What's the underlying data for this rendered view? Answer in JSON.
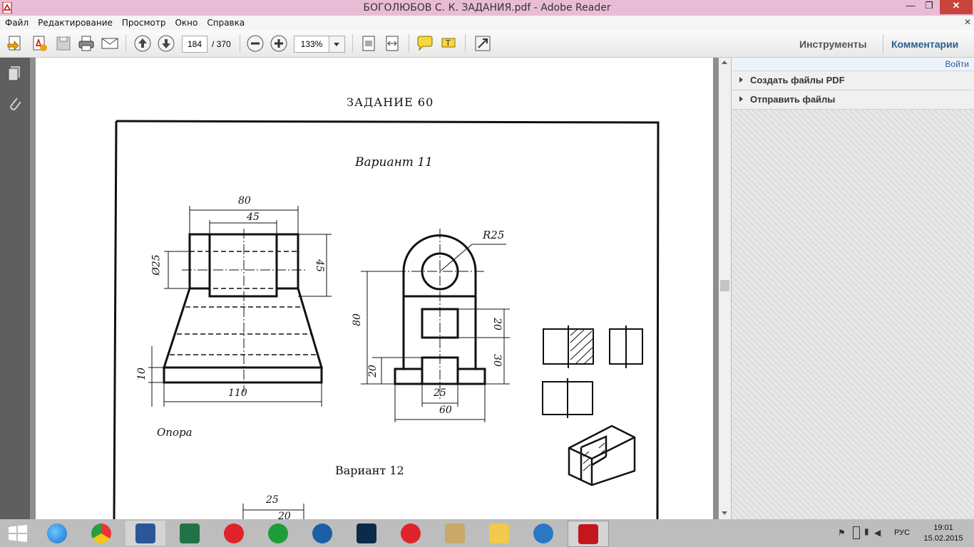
{
  "window": {
    "title": "БОГОЛЮБОВ С. К. ЗАДАНИЯ.pdf - Adobe Reader"
  },
  "menu": [
    "Файл",
    "Редактирование",
    "Просмотр",
    "Окно",
    "Справка"
  ],
  "toolbar": {
    "page_current": "184",
    "page_total": "/ 370",
    "zoom": "133%",
    "tools_label": "Инструменты",
    "comments_label": "Комментарии"
  },
  "panel": {
    "signin": "Войти",
    "items": [
      {
        "label": "Создать файлы PDF"
      },
      {
        "label": "Отправить файлы"
      }
    ]
  },
  "document": {
    "task_title": "ЗАДАНИЕ 60",
    "variant_11": "Вариант 11",
    "variant_12": "Вариант 12",
    "part_name": "Опора",
    "dims": {
      "d80_top": "80",
      "d45_top": "45",
      "d25_dia": "Ø25",
      "d45_side": "45",
      "d10": "10",
      "d110": "110",
      "r25": "R25",
      "d80_left": "80",
      "d20_right": "20",
      "d30_right": "30",
      "d20_left": "20",
      "d25_bottom": "25",
      "d60_bottom": "60",
      "d25_v12": "25",
      "d20_v12": "20"
    }
  },
  "taskbar": {
    "lang": "РУС",
    "time": "19:01",
    "date": "15.02.2015"
  }
}
